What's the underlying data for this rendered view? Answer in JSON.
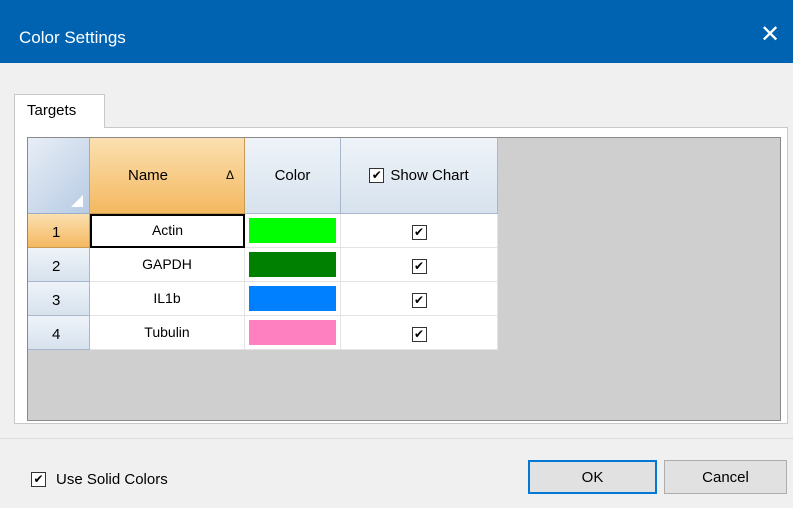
{
  "window": {
    "title": "Color Settings",
    "close_glyph": "✕"
  },
  "tabs": [
    {
      "label": "Targets"
    }
  ],
  "grid": {
    "columns": {
      "name": "Name",
      "sort_glyph": "Δ",
      "color": "Color",
      "show_chart": "Show Chart"
    },
    "show_chart_header_checked": true,
    "rows": [
      {
        "index": "1",
        "name": "Actin",
        "color": "#00ff00",
        "show_chart": true
      },
      {
        "index": "2",
        "name": "GAPDH",
        "color": "#008000",
        "show_chart": true
      },
      {
        "index": "3",
        "name": "IL1b",
        "color": "#0080ff",
        "show_chart": true
      },
      {
        "index": "4",
        "name": "Tubulin",
        "color": "#ff80c0",
        "show_chart": true
      }
    ]
  },
  "footer": {
    "use_solid_colors_label": "Use Solid Colors",
    "use_solid_colors_checked": true,
    "ok_label": "OK",
    "cancel_label": "Cancel"
  },
  "check_glyph": "✔"
}
